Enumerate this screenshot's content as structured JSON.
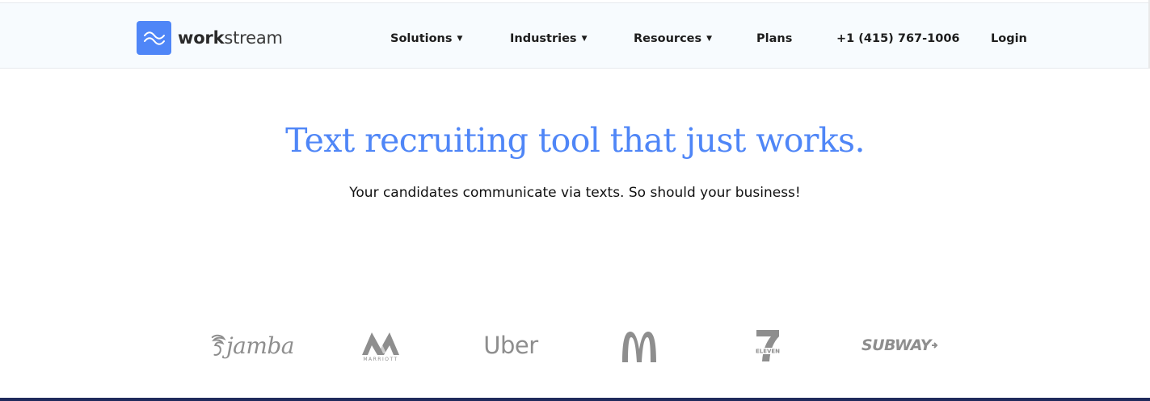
{
  "header": {
    "logo": {
      "bold": "work",
      "light": "stream",
      "icon": "waves-icon",
      "icon_color": "#4f86f7"
    },
    "nav": [
      {
        "label": "Solutions",
        "has_dropdown": true
      },
      {
        "label": "Industries",
        "has_dropdown": true
      },
      {
        "label": "Resources",
        "has_dropdown": true
      },
      {
        "label": "Plans",
        "has_dropdown": false
      },
      {
        "label": "+1 (415) 767-1006",
        "has_dropdown": false
      },
      {
        "label": "Login",
        "has_dropdown": false
      }
    ],
    "caret": "▼"
  },
  "hero": {
    "title": "Text recruiting tool that just works.",
    "subtitle": "Your candidates communicate via texts. So should your business!",
    "title_color": "#4f86f7"
  },
  "customer_logos": {
    "jamba": "jamba",
    "marriott": "MARRIOTT",
    "uber": "Uber",
    "mcdonalds_icon": "golden-arches-icon",
    "seven_eleven": "ELEVEN",
    "subway": "SUBWAY"
  },
  "colors": {
    "accent": "#4f86f7",
    "logo_gray": "#8e8e8e",
    "footer_bar": "#1f2a5c"
  }
}
